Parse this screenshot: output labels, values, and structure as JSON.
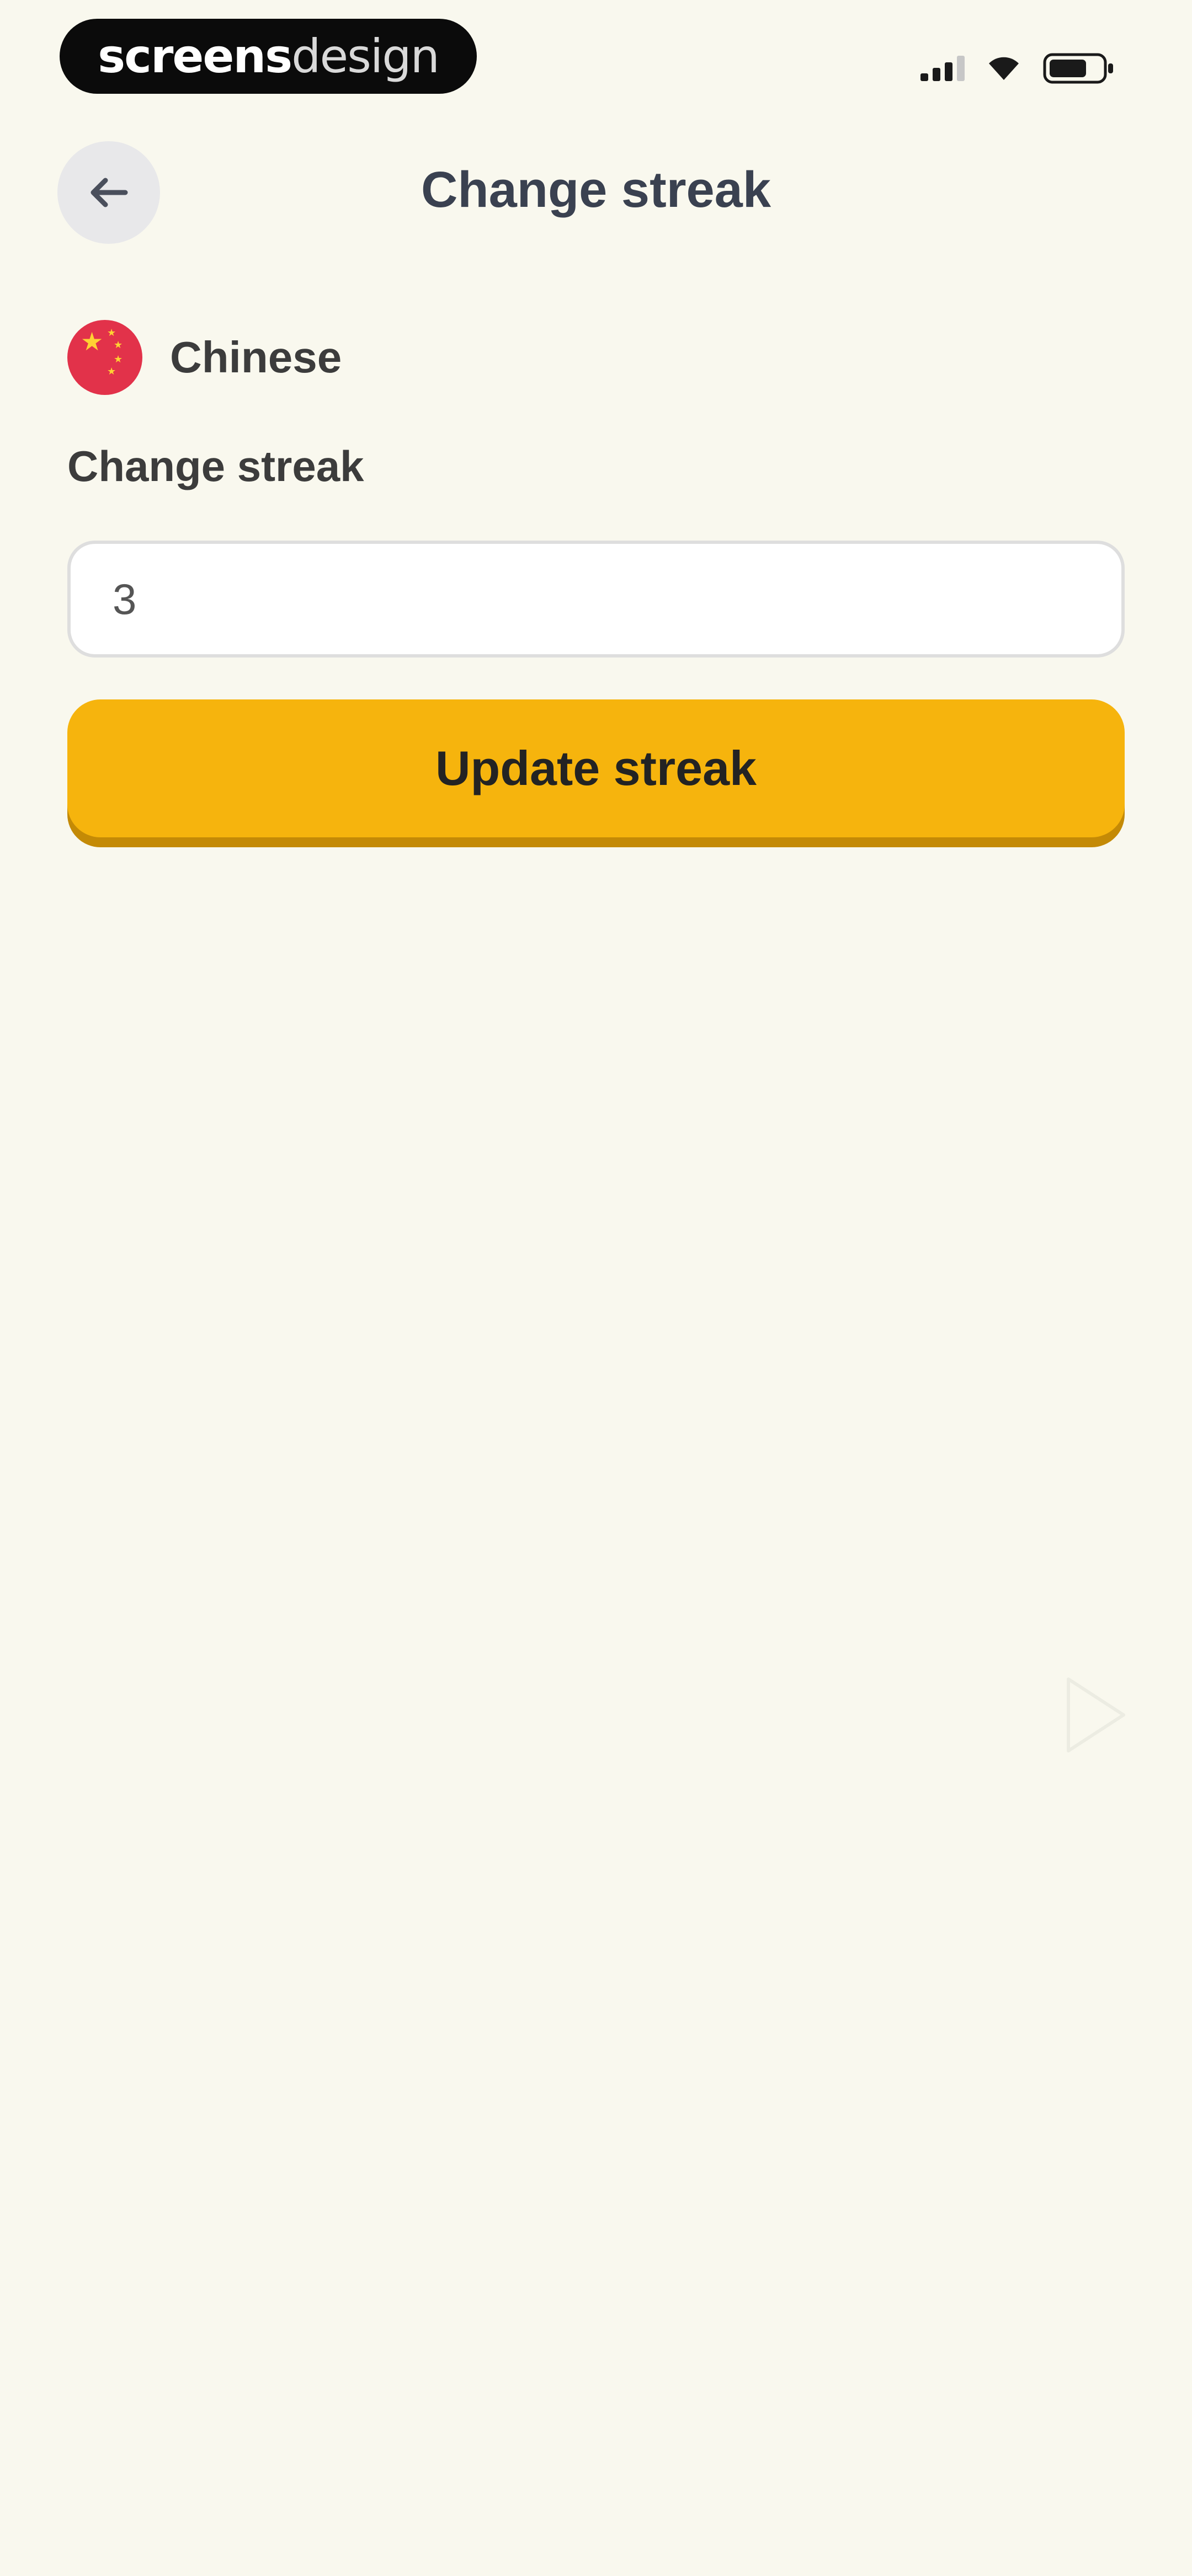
{
  "watermark": {
    "brand_bold": "screens",
    "brand_light": "design"
  },
  "header": {
    "title": "Change streak",
    "back_icon": "arrow-left-icon"
  },
  "language": {
    "name": "Chinese",
    "flag_icon": "china-flag-icon"
  },
  "streak_field": {
    "label": "Change streak",
    "value": "3"
  },
  "actions": {
    "update_label": "Update streak"
  },
  "colors": {
    "background": "#f9f8ee",
    "accent": "#f6b40d",
    "accent_shadow": "#c48a06",
    "title_text": "#3a4150",
    "flag_red": "#e2324a"
  }
}
